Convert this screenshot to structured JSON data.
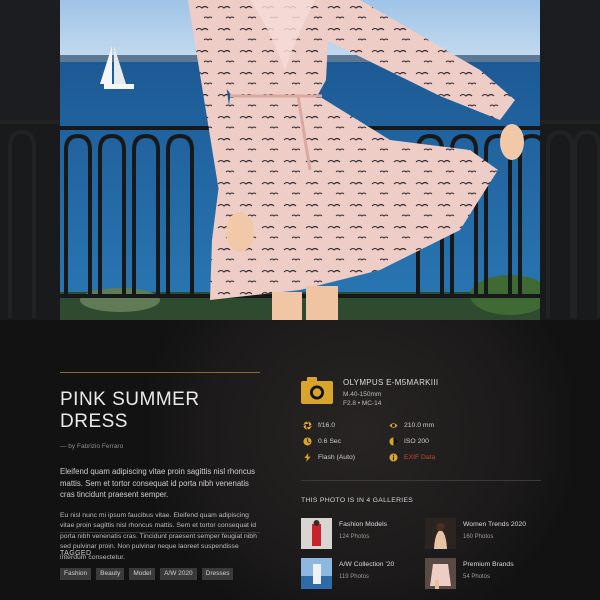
{
  "photo": {
    "title": "PINK SUMMER DRESS",
    "byline": "— by Fabrizio Ferraro",
    "lead": "Eleifend quam adipiscing vitae proin sagittis nisl rhoncus mattis. Sem et tortor consequat id porta nibh venenatis cras tincidunt praesent semper.",
    "body": "Eu nisl nunc mi ipsum faucibus vitae. Eleifend quam adipiscing vitae proin sagittis nisl rhoncus mattis. Sem et tortor consequat id porta nibh venenatis cras. Tincidunt praesent semper feugiat nibh sed pulvinar proin. Non pulvinar neque laoreet suspendisse interdum consectetur."
  },
  "tagged": {
    "label": "TAGGED",
    "tags": [
      "Fashion",
      "Beauty",
      "Model",
      "A/W 2020",
      "Dresses"
    ]
  },
  "camera": {
    "name": "OLYMPUS E-M5MARKIII",
    "lens": "M.40-150mm",
    "settings": "F2.8 • MC-14",
    "icon": "camera-icon"
  },
  "specs": {
    "aperture": "f/16.0",
    "focal": "210.0 mm",
    "shutter": "0.6 Sec",
    "iso": "ISO 200",
    "flash": "Flash (Auto)",
    "exif": "EXIF Data"
  },
  "galleries": {
    "heading": "THIS PHOTO IS IN 4 GALLERIES",
    "items": [
      {
        "name": "Fashion Models",
        "count": "124 Photos"
      },
      {
        "name": "Women Trends 2020",
        "count": "160 Photos"
      },
      {
        "name": "A/W Collection '20",
        "count": "119 Photos"
      },
      {
        "name": "Premium Brands",
        "count": "54 Photos"
      }
    ]
  },
  "colors": {
    "accent_gold": "#d9a42b",
    "link_red": "#c7452d",
    "background": "#121212",
    "dress_pink": "#f0cfc9",
    "sea_blue": "#1f5d94"
  }
}
